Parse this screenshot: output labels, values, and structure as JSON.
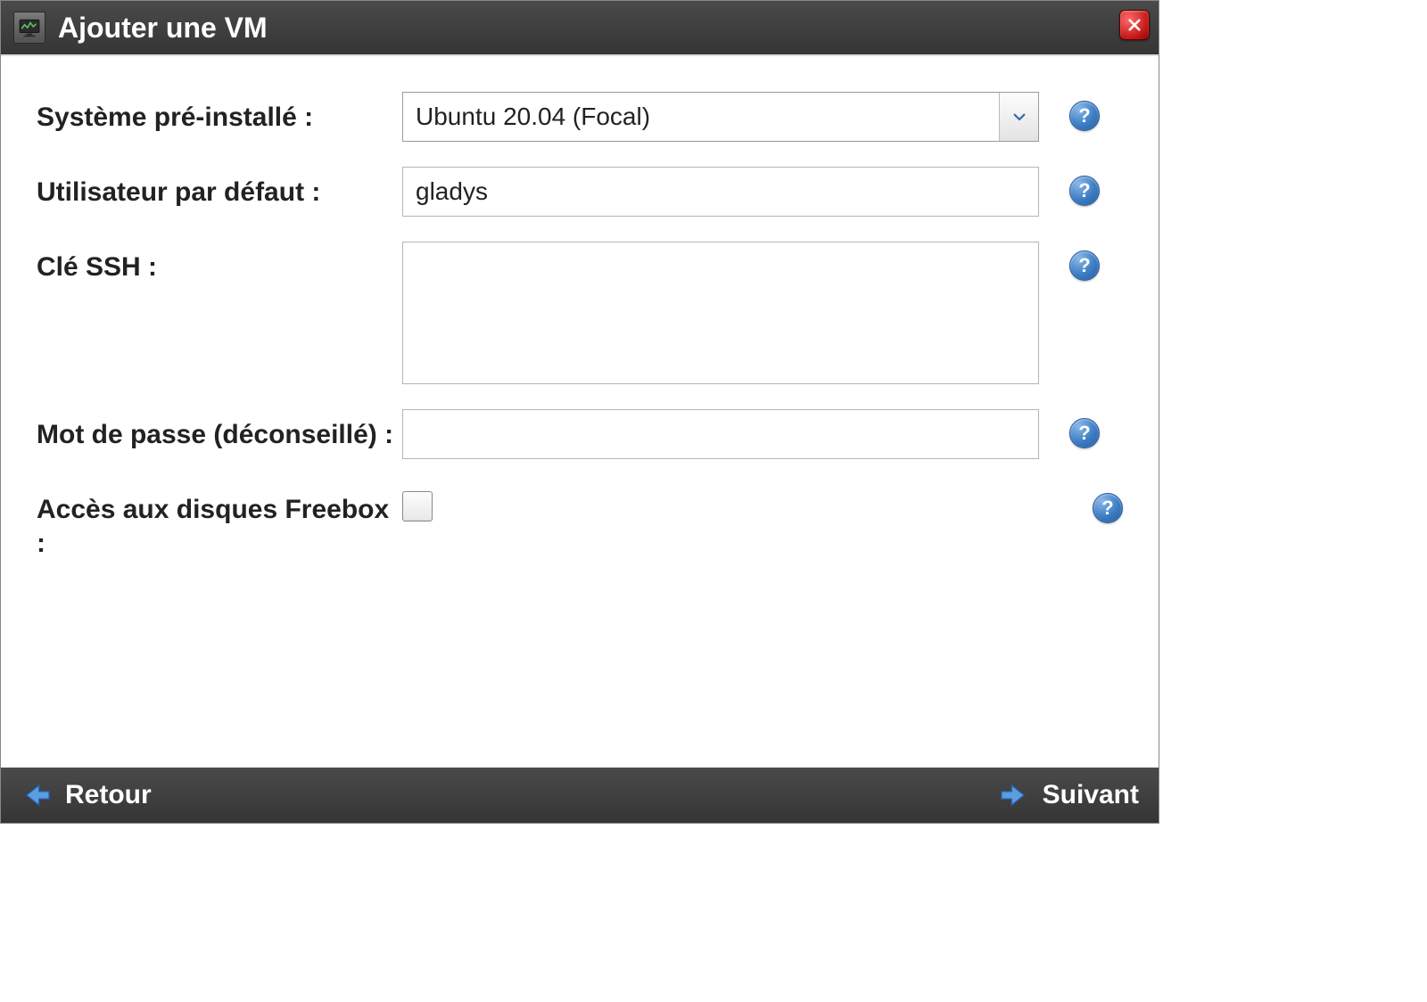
{
  "dialog": {
    "title": "Ajouter une VM"
  },
  "form": {
    "system": {
      "label": "Système pré-installé :",
      "value": "Ubuntu 20.04 (Focal)"
    },
    "user": {
      "label": "Utilisateur par défaut :",
      "value": "gladys"
    },
    "ssh": {
      "label": "Clé SSH :",
      "value": ""
    },
    "password": {
      "label": "Mot de passe (déconseillé) :",
      "value": ""
    },
    "disk_access": {
      "label": "Accès aux disques Freebox :",
      "checked": false
    }
  },
  "footer": {
    "back": "Retour",
    "next": "Suivant"
  },
  "help_symbol": "?"
}
